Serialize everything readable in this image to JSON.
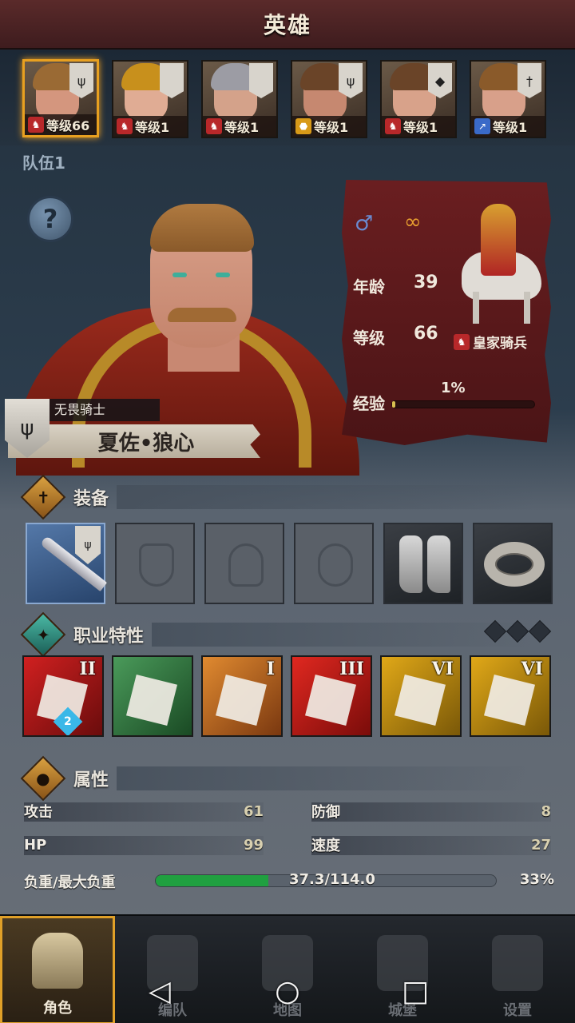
{
  "header": {
    "title": "英雄"
  },
  "heroes": [
    {
      "level": "等级66",
      "class_icon": "horse-icon",
      "class_color": "#b8282a",
      "banner": "wolf-crest",
      "hair": "#9a6a34",
      "skin": "#d4967e"
    },
    {
      "level": "等级1",
      "class_icon": "horse-icon",
      "class_color": "#b8282a",
      "banner": "",
      "hair": "#c8901c",
      "skin": "#e0ac94"
    },
    {
      "level": "等级1",
      "class_icon": "horse-icon",
      "class_color": "#b8282a",
      "banner": "",
      "hair": "#9c9ca4",
      "skin": "#d4a28a"
    },
    {
      "level": "等级1",
      "class_icon": "shield-icon",
      "class_color": "#d89a18",
      "banner": "wolf-crest",
      "hair": "#6a4428",
      "skin": "#c68870"
    },
    {
      "level": "等级1",
      "class_icon": "horse-icon",
      "class_color": "#b8282a",
      "banner": "diamond-crest",
      "hair": "#6a4428",
      "skin": "#d8a28a"
    },
    {
      "level": "等级1",
      "class_icon": "lance-icon",
      "class_color": "#3a6ac8",
      "banner": "sword-crest",
      "hair": "#8a5a2a",
      "skin": "#d8a08a"
    }
  ],
  "team": {
    "label": "队伍1"
  },
  "portrait": {
    "class_title": "无畏骑士",
    "name": "夏佐•狼心"
  },
  "info": {
    "gender_symbol": "♂",
    "married_symbol": "∞",
    "age_label": "年龄",
    "age_value": "39",
    "level_label": "等级",
    "level_value": "66",
    "class_name": "皇家骑兵",
    "exp_label": "经验",
    "exp_percent": "1%",
    "exp_fraction": 0.01
  },
  "equipment": {
    "title": "装备",
    "slots": [
      {
        "name": "weapon-slot",
        "state": "equipped-sword"
      },
      {
        "name": "shield-slot",
        "state": "empty"
      },
      {
        "name": "helmet-slot",
        "state": "empty"
      },
      {
        "name": "armor-slot",
        "state": "empty"
      },
      {
        "name": "boots-slot",
        "state": "equipped-boots"
      },
      {
        "name": "ring-slot",
        "state": "equipped-ring"
      }
    ]
  },
  "traits": {
    "title": "职业特性",
    "skills": [
      {
        "name": "charge-target-skill",
        "rank": "II",
        "count": "2",
        "color1": "#d02020",
        "color2": "#6a0c0c"
      },
      {
        "name": "ride-skill",
        "rank": "",
        "count": "",
        "color1": "#4a9a5a",
        "color2": "#1a4a24"
      },
      {
        "name": "sword-up-skill",
        "rank": "I",
        "count": "",
        "color1": "#e08a30",
        "color2": "#7a3810"
      },
      {
        "name": "sword-strike-skill",
        "rank": "III",
        "count": "",
        "color1": "#e02820",
        "color2": "#7a0c0a"
      },
      {
        "name": "shield-break-skill-1",
        "rank": "VI",
        "count": "",
        "color1": "#e0a818",
        "color2": "#7a5808"
      },
      {
        "name": "shield-break-skill-2",
        "rank": "VI",
        "count": "",
        "color1": "#e0a818",
        "color2": "#7a5808"
      }
    ]
  },
  "attributes": {
    "title": "属性",
    "attack_label": "攻击",
    "attack_value": "61",
    "defense_label": "防御",
    "defense_value": "8",
    "hp_label": "HP",
    "hp_value": "99",
    "speed_label": "速度",
    "speed_value": "27",
    "load_label": "负重/最大负重",
    "load_value": "37.3/114.0",
    "load_percent": "33%",
    "load_fraction": 0.33
  },
  "nav": {
    "items": [
      {
        "label": "角色",
        "icon": "knight-icon",
        "active": true
      },
      {
        "label": "编队",
        "icon": "formation-icon",
        "active": false
      },
      {
        "label": "地图",
        "icon": "compass-icon",
        "active": false
      },
      {
        "label": "城堡",
        "icon": "castle-icon",
        "active": false
      },
      {
        "label": "设置",
        "icon": "gear-icon",
        "active": false
      }
    ]
  },
  "system": {
    "back": "◁",
    "home": "○",
    "recent": "□"
  }
}
